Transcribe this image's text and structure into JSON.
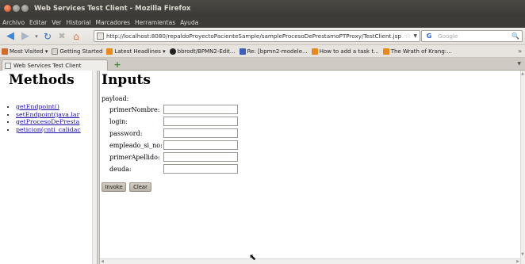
{
  "window": {
    "title": "Web Services Test Client - Mozilla Firefox"
  },
  "menu": [
    "Archivo",
    "Editar",
    "Ver",
    "Historial",
    "Marcadores",
    "Herramientas",
    "Ayuda"
  ],
  "nav": {
    "url": "http://localhost:8080/repaldoProyectoPacienteSample/sampleProcesoDePrestamoPTProxy/TestClient.jsp",
    "search_placeholder": "Google",
    "search_engine": "Google"
  },
  "bookmarks": [
    {
      "label": "Most Visited ▾",
      "color": "#d26c2d"
    },
    {
      "label": "Getting Started",
      "color": "#8a8780"
    },
    {
      "label": "Latest Headlines ▾",
      "color": "#e8891f"
    },
    {
      "label": "bbrodt/BPMN2-Edit...",
      "color": "#222222"
    },
    {
      "label": "Re: [bpmn2-modele...",
      "color": "#3b5fb8"
    },
    {
      "label": "How to add a task t...",
      "color": "#e8891f"
    },
    {
      "label": "The Wrath of Krang:...",
      "color": "#e8891f"
    }
  ],
  "tabs": [
    {
      "label": "Web Services Test Client"
    }
  ],
  "left_frame": {
    "heading": "Methods",
    "methods": [
      "getEndpoint()",
      "setEndpoint(java.lar",
      "getProcesoDePresta",
      "peticion(cnti_calidac"
    ]
  },
  "right_frame": {
    "heading": "Inputs",
    "payload_label": "payload:",
    "fields": [
      {
        "label": "primerNombre:",
        "value": ""
      },
      {
        "label": "login:",
        "value": ""
      },
      {
        "label": "password:",
        "value": ""
      },
      {
        "label": "empleado_si_no:",
        "value": ""
      },
      {
        "label": "primerApellido:",
        "value": ""
      },
      {
        "label": "deuda:",
        "value": ""
      }
    ],
    "invoke_label": "Invoke",
    "clear_label": "Clear"
  },
  "colors": {
    "titlebar": "#3c3b37",
    "link": "#1a0dab",
    "button": "#c4beb3"
  }
}
